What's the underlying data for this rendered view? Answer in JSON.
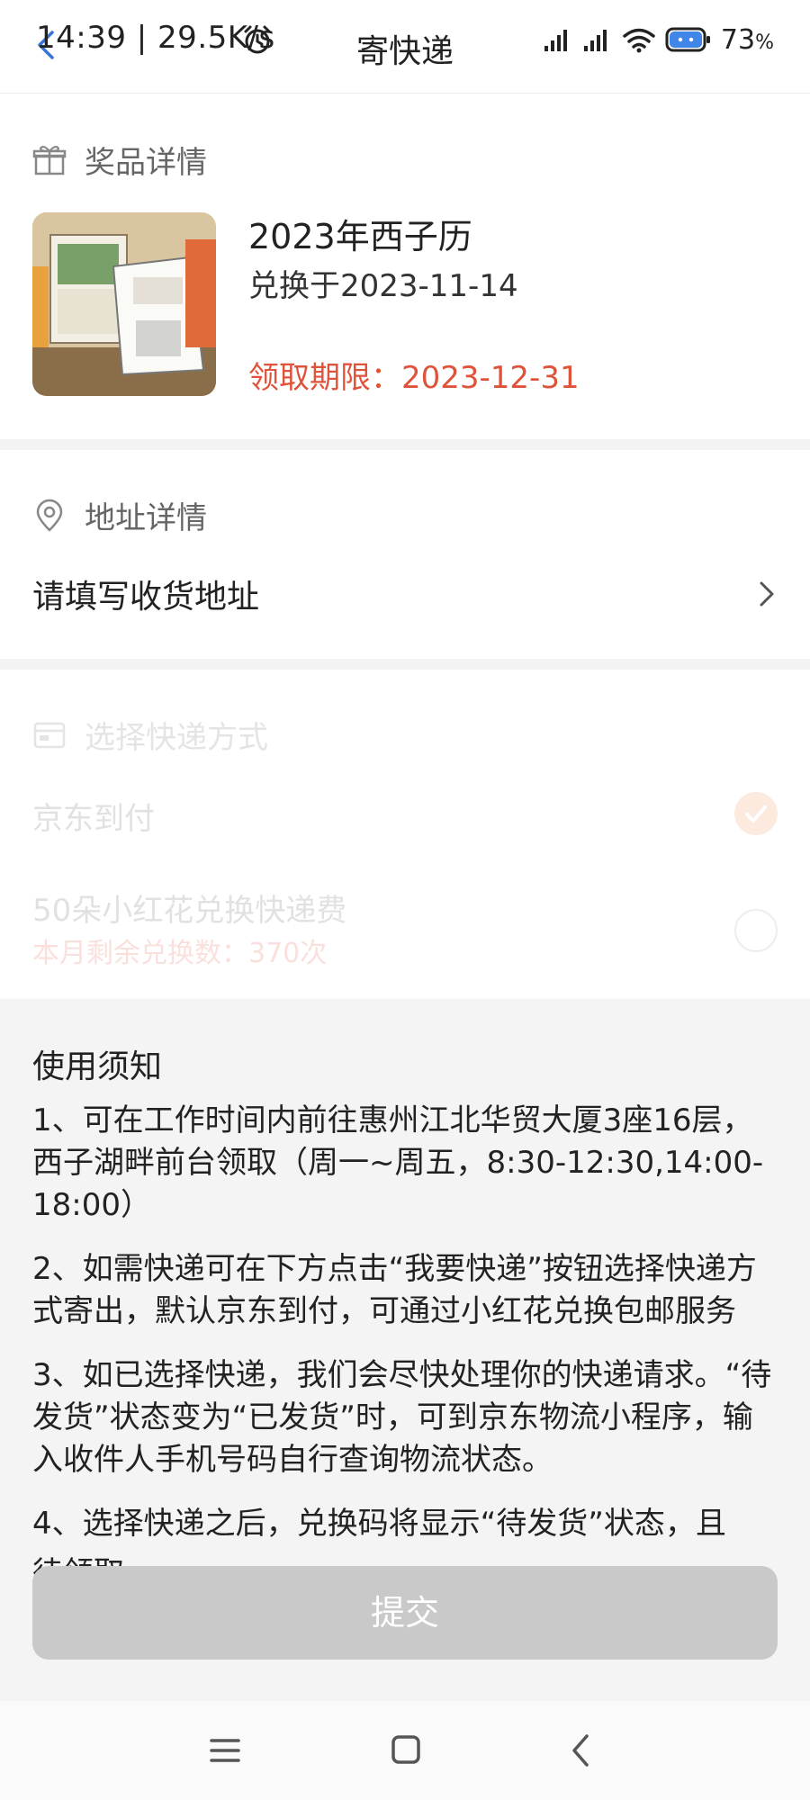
{
  "status_bar": {
    "time_speed": "14:39 | 29.5K/s",
    "battery": "73",
    "battery_unit": "%"
  },
  "header": {
    "title": "寄快递"
  },
  "prize": {
    "section_title": "奖品详情",
    "name": "2023年西子历",
    "redeemed": "兑换于2023-11-14",
    "deadline": "领取期限：2023-12-31"
  },
  "address": {
    "section_title": "地址详情",
    "placeholder": "请填写收货地址"
  },
  "shipping": {
    "section_title": "选择快递方式",
    "option1": "京东到付",
    "option2": "50朵小红花兑换快递费",
    "option2_sub": "本月剩余兑换数：370次"
  },
  "notice": {
    "title": "使用须知",
    "items": [
      "1、可在工作时间内前往惠州江北华贸大厦3座16层，西子湖畔前台领取（周一~周五，8:30-12:30,14:00-18:00）",
      "2、如需快递可在下方点击“我要快递”按钮选择快递方式寄出，默认京东到付，可通过小红花兑换包邮服务",
      "3、如已选择快递，我们会尽快处理你的快递请求。“待发货”状态变为“已发货”时，可到京东物流小程序，输入收件人手机号码自行查询物流状态。",
      "4、选择快递之后，兑换码将显示“待发货”状态，且"
    ],
    "trailing": "待领取"
  },
  "submit_label": "提交",
  "colors": {
    "accent": "#e0533b",
    "button": "#c9c9c9",
    "radio": "#f08a4b"
  }
}
